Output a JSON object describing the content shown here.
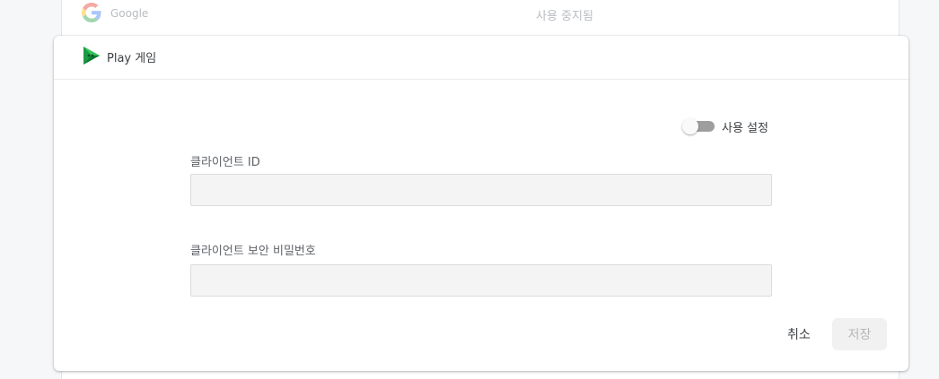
{
  "background_list": {
    "provider_name": "Google",
    "provider_status": "사용 중지됨"
  },
  "card": {
    "title": "Play 게임",
    "toggle": {
      "label": "사용 설정",
      "enabled": false
    },
    "fields": {
      "client_id": {
        "label": "클라이언트 ID",
        "value": ""
      },
      "client_secret": {
        "label": "클라이언트 보안 비밀번호",
        "value": ""
      }
    },
    "actions": {
      "cancel_label": "취소",
      "save_label": "저장",
      "save_disabled": true
    }
  },
  "icons": {
    "google": "google-g-icon",
    "play_games": "play-games-icon"
  },
  "colors": {
    "page_background": "#f6f7f9",
    "card_background": "#ffffff",
    "input_background": "#f4f4f4",
    "toggle_track_off": "#9e9e9e",
    "save_disabled_bg": "#f1f1f1",
    "save_disabled_text": "#b7b7b7"
  }
}
